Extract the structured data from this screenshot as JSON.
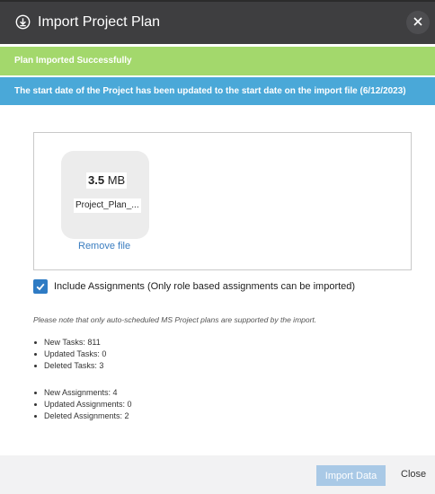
{
  "dialog": {
    "title": "Import Project Plan",
    "header_icon": "import-icon",
    "close_icon": "close-icon"
  },
  "banners": {
    "success": "Plan Imported Successfully",
    "info": "The start date of the Project has been updated to the start date on the import file (6/12/2023)"
  },
  "file": {
    "size_value": "3.5",
    "size_unit": "MB",
    "name": "Project_Plan_...",
    "remove_label": "Remove file"
  },
  "options": {
    "include_assignments_label": "Include Assignments (Only role based assignments can be imported)",
    "include_assignments_checked": true
  },
  "note": "Please note that only auto-scheduled MS Project plans are supported by the import.",
  "stats": {
    "tasks": [
      "New Tasks: 811",
      "Updated Tasks: 0",
      "Deleted Tasks: 3"
    ],
    "assignments": [
      "New Assignments: 4",
      "Updated Assignments: 0",
      "Deleted Assignments: 2"
    ]
  },
  "footer": {
    "import_label": "Import Data",
    "close_label": "Close"
  },
  "colors": {
    "header_bg": "#3e3e40",
    "success_bg": "#a3d86c",
    "info_bg": "#4aa8d8",
    "accent": "#2e7bc4",
    "disabled_button": "#a9c9e6"
  }
}
